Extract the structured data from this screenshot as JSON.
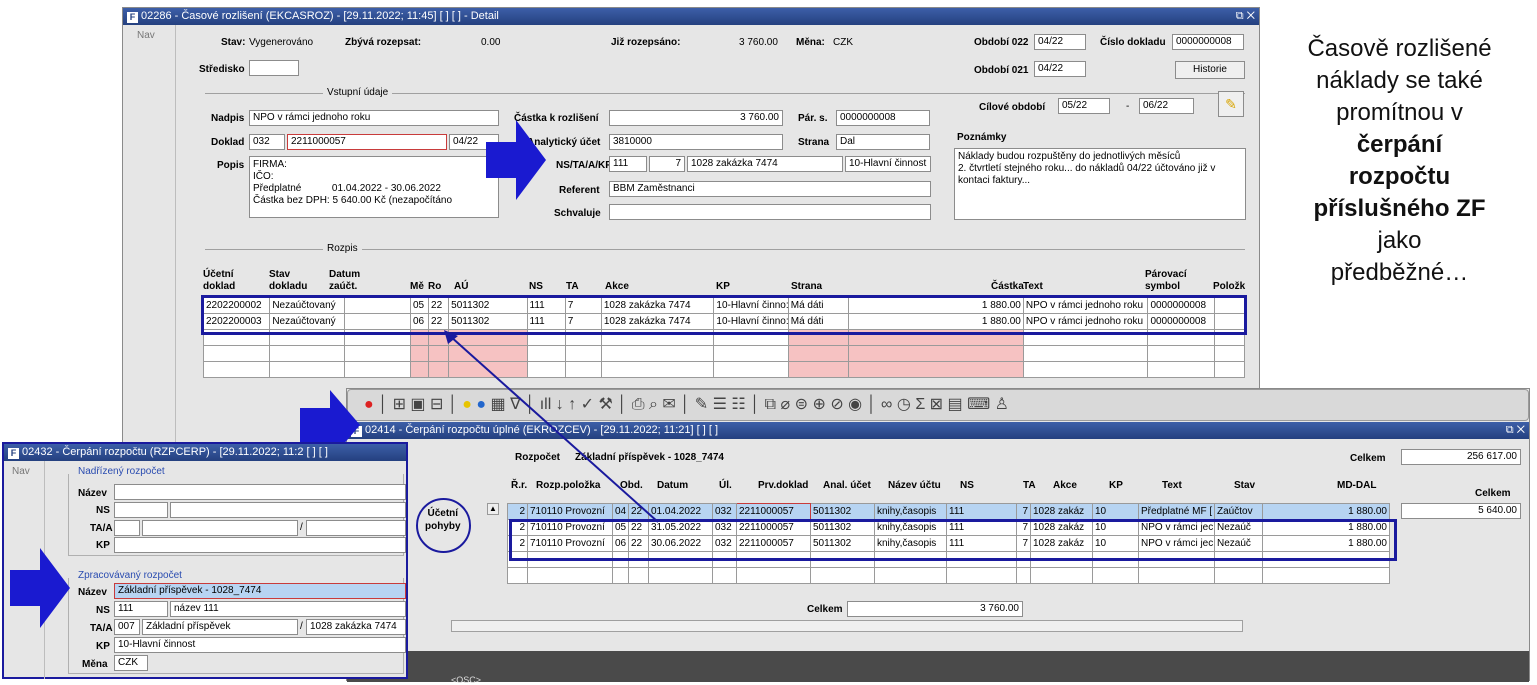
{
  "w1": {
    "title": "02286 - Časové rozlišení (EKCASROZ) - [29.11.2022; 11:45]  [ ]  [ ] - Detail",
    "nav": "Nav",
    "stav_l": "Stav:",
    "stav_v": "Vygenerováno",
    "zbyva_l": "Zbývá rozepsat:",
    "zbyva_v": "0.00",
    "jiz_l": "Již rozepsáno:",
    "jiz_v": "3 760.00",
    "mena_l": "Měna:",
    "mena_v": "CZK",
    "o22_l": "Období 022",
    "o22_v": "04/22",
    "cislo_l": "Číslo dokladu",
    "cislo_v": "0000000008",
    "stredisko_l": "Středisko",
    "o21_l": "Období 021",
    "o21_v": "04/22",
    "historie": "Historie",
    "vstupni": "Vstupní údaje",
    "cilove_l": "Cílové období",
    "cilove_od": "05/22",
    "cilove_sep": "-",
    "cilove_do": "06/22",
    "nadpis_l": "Nadpis",
    "nadpis_v": "NPO v rámci jednoho roku",
    "doklad_l": "Doklad",
    "doklad_1": "032",
    "doklad_2": "2211000057",
    "doklad_3": "04/22",
    "popis_l": "Popis",
    "popis_v": "FIRMA:\nIČO:\nPředplatné           01.04.2022 - 30.06.2022\nČástka bez DPH: 5 640.00 Kč (nezapočítáno",
    "castka_l": "Částka k rozlišení",
    "castka_v": "3 760.00",
    "pars_l": "Pár. s.",
    "pars_v": "0000000008",
    "anal_l": "Analytický účet",
    "anal_v": "3810000",
    "strana_l": "Strana",
    "strana_v": "Dal",
    "ns_l": "NS/TA/A/KP",
    "ns_1": "111",
    "ns_2": "7",
    "ns_3": "1028 zakázka 7474",
    "ns_4": "10-Hlavní činnost",
    "referent_l": "Referent",
    "referent_v": "BBM Zaměstnanci",
    "schval_l": "Schvaluje",
    "poznamky_l": "Poznámky",
    "poznamky_v": "Náklady budou rozpuštěny do jednotlivých měsíců\n2. čtvrtletí stejného roku... do nákladů 04/22 účtováno již v kontaci faktury...",
    "rozpis": "Rozpis",
    "headers": [
      "Účetní\ndoklad",
      "Stav\ndokladu",
      "Datum\nzaúčt.",
      "Mě",
      "Ro",
      "AÚ",
      "NS",
      "TA",
      "Akce",
      "KP",
      "Strana",
      "Částka",
      "Text",
      "Párovací\nsymbol",
      "Položk"
    ],
    "rows": [
      [
        "2202200002",
        "Nezaúčtovaný",
        "",
        "05",
        "22",
        "5011302",
        "111",
        "7",
        "1028 zakázka 7474",
        "10-Hlavní činno:",
        "Má dáti",
        "1 880.00",
        "NPO v rámci jednoho roku",
        "0000000008",
        ""
      ],
      [
        "2202200003",
        "Nezaúčtovaný",
        "",
        "06",
        "22",
        "5011302",
        "111",
        "7",
        "1028 zakázka 7474",
        "10-Hlavní činno:",
        "Má dáti",
        "1 880.00",
        "NPO v rámci jednoho roku",
        "0000000008",
        ""
      ]
    ]
  },
  "w2": {
    "title": "02432 - Čerpání rozpočtu (RZPCERP) - [29.11.2022; 11:2  [ ]  [ ]",
    "nav": "Nav",
    "nadrizeny": "Nadřízený rozpočet",
    "nazev_l": "Název",
    "ns_l": "NS",
    "ta_l": "TA/A",
    "kp_l": "KP",
    "slash": "/",
    "zprac": "Zpracovávaný rozpočet",
    "nazev_v": "Základní příspěvek - 1028_7474",
    "ns_1": "111",
    "ns_2": "název 111",
    "ta_1": "007",
    "ta_2": "Základní příspěvek",
    "ta_3": "1028 zakázka 7474",
    "kp_v": "10-Hlavní činnost",
    "mena_l": "Měna",
    "mena_v": "CZK"
  },
  "w3": {
    "title": "02414 - Čerpání rozpočtu úplné (EKROZCEV) - [29.11.2022; 11:21]  [ ]  [ ]",
    "rozpocet_l": "Rozpočet",
    "rozpocet_v": "Základní příspěvek - 1028_7474",
    "celkem_l": "Celkem",
    "celkem_v": "256 617.00",
    "celkem2_l": "Celkem",
    "celkem2_v": "5 640.00",
    "ucetni": "Účetní\npohyby",
    "headers": [
      "Ř.r.",
      "Rozp.položka",
      "Obd.",
      "Datum",
      "Úl.",
      "Prv.doklad",
      "Anal. účet",
      "Název účtu",
      "NS",
      "TA",
      "Akce",
      "KP",
      "Text",
      "Stav",
      "MD-DAL"
    ],
    "rows": [
      [
        "2",
        "710110 Provozní",
        "04",
        "22",
        "01.04.2022",
        "032",
        "2211000057",
        "5011302",
        "knihy,časopis",
        "111",
        "7",
        "1028 zakáz",
        "10",
        "Předplatné MF [",
        "Zaúčtov",
        "1 880.00"
      ],
      [
        "2",
        "710110 Provozní",
        "05",
        "22",
        "31.05.2022",
        "032",
        "2211000057",
        "5011302",
        "knihy,časopis",
        "111",
        "7",
        "1028 zakáz",
        "10",
        "NPO v rámci jec",
        "Nezaúč",
        "1 880.00"
      ],
      [
        "2",
        "710110 Provozní",
        "06",
        "22",
        "30.06.2022",
        "032",
        "2211000057",
        "5011302",
        "knihy,časopis",
        "111",
        "7",
        "1028 zakáz",
        "10",
        "NPO v rámci jec",
        "Nezaúč",
        "1 880.00"
      ]
    ],
    "foot_l": "Celkem",
    "foot_v": "3 760.00",
    "status": "<OSC>"
  },
  "caption": {
    "l1": "Časově rozlišené",
    "l2": "náklady se také",
    "l3": "promítnou v",
    "b1": "čerpání",
    "b2": "rozpočtu",
    "b3": "příslušného ZF",
    "l4": "jako",
    "l5": "předběžné…"
  },
  "colors": {
    "highlight": "#1a1a9e",
    "title_bar": "#24407f",
    "selected": "#b7d4f2",
    "pink": "#f6c2c2"
  }
}
